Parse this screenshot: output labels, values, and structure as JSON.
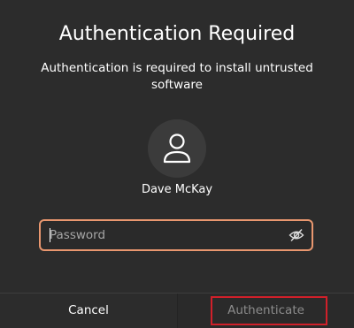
{
  "dialog": {
    "title": "Authentication Required",
    "message": "Authentication is required to install untrusted software"
  },
  "user": {
    "name": "Dave McKay",
    "avatar_icon": "user-avatar-icon"
  },
  "password": {
    "placeholder": "Password",
    "value": "",
    "reveal_icon": "eye-slash-icon"
  },
  "buttons": {
    "cancel_label": "Cancel",
    "authenticate_label": "Authenticate"
  },
  "colors": {
    "background": "#2c2c2c",
    "focus_border": "#e9976f",
    "highlight_border": "#d0202a",
    "disabled_text": "#8c8c8c"
  }
}
